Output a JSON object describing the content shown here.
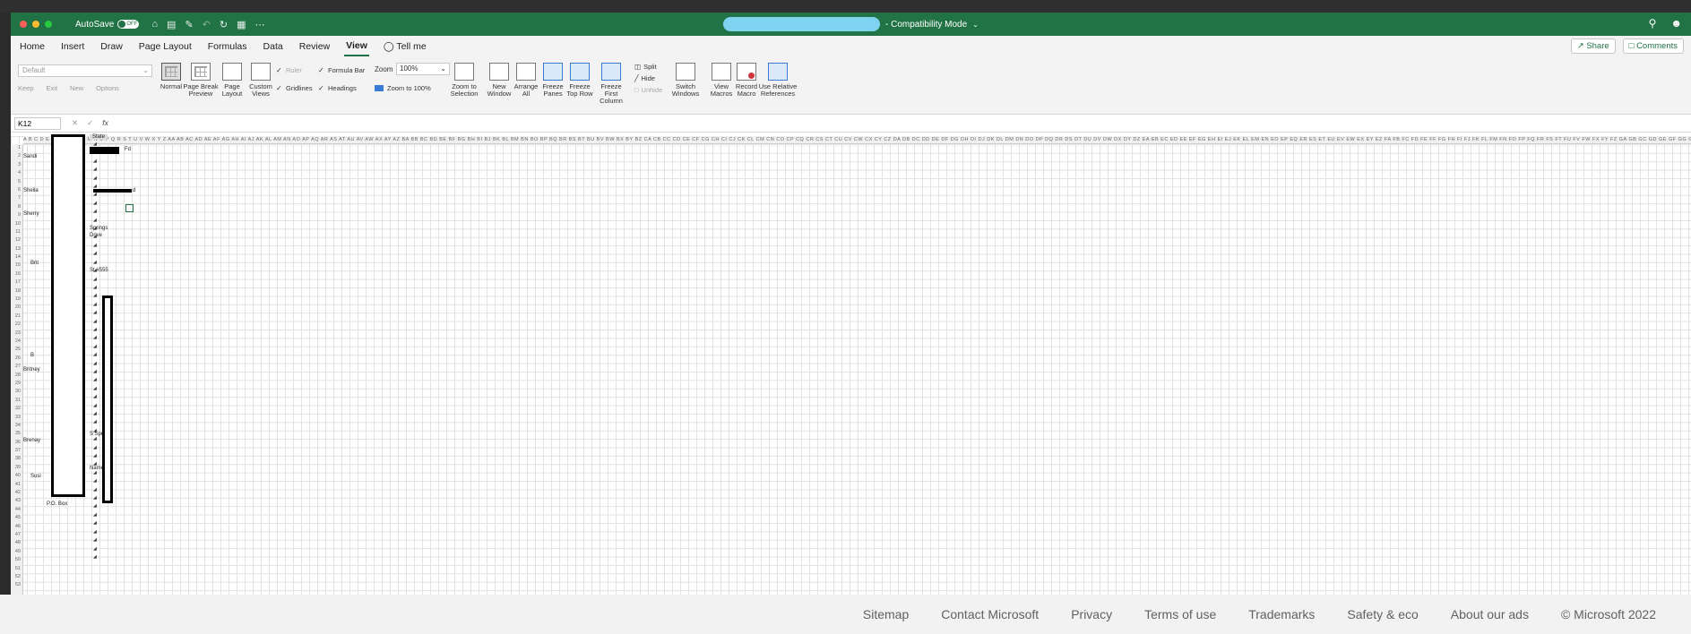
{
  "titlebar": {
    "autosave_label": "AutoSave",
    "autosave_state": "OFF",
    "mode_label": "- Compatibility Mode",
    "colors": {
      "titlebar": "#217346",
      "redacted_filename": "#7fd3f0"
    }
  },
  "menu": {
    "tabs": [
      "Home",
      "Insert",
      "Draw",
      "Page Layout",
      "Formulas",
      "Data",
      "Review",
      "View",
      "Tell me"
    ],
    "active_tab": "View",
    "share_label": "Share",
    "comments_label": "Comments"
  },
  "ribbon": {
    "sheet_view_select": "Default",
    "sheet_view_buttons": [
      "Keep",
      "Exit",
      "New",
      "Options"
    ],
    "views": [
      {
        "label": "Normal"
      },
      {
        "label": "Page Break Preview"
      },
      {
        "label": "Page Layout"
      },
      {
        "label": "Custom Views"
      }
    ],
    "show": {
      "ruler": "Ruler",
      "formula_bar": "Formula Bar",
      "gridlines": "Gridlines",
      "headings": "Headings"
    },
    "zoom": {
      "label": "Zoom",
      "value": "100%",
      "zoom_100": "Zoom to 100%",
      "zoom_selection": "Zoom to Selection"
    },
    "window": {
      "new_window": "New Window",
      "arrange_all": "Arrange All",
      "freeze_panes": "Freeze Panes",
      "freeze_top_row": "Freeze Top Row",
      "freeze_first_col": "Freeze First Column",
      "split": "Split",
      "hide": "Hide",
      "unhide": "Unhide",
      "switch_windows": "Switch Windows"
    },
    "macros": {
      "view_macros": "View Macros",
      "record_macro": "Record Macro",
      "relative_refs": "Use Relative References"
    }
  },
  "formula_bar": {
    "name_box": "K12",
    "fx": "fx"
  },
  "sheet": {
    "column_headers": "A B C D E F G H I J K L M N O P Q R S T U V W X Y Z AA AB AC AD AE AF AG AH AI AJ AK AL AM AN AO AP AQ AR AS AT AU AV AW AX AY AZ BA BB BC BD BE BF BG BH BI BJ BK BL BM BN BO BP BQ BR BS BT BU BV BW BX BY BZ CA CB CC CD CE CF CG CH CI CJ CK CL CM CN CO CP CQ CR CS CT CU CV CW CX CY CZ DA DB DC DD DE DF DG DH DI DJ DK DL DM DN DO DP DQ DR DS DT DU DV DW DX DY DZ EA EB EC ED EE EF EG EH EI EJ EK EL EM EN EO EP EQ ER ES ET EU EV EW EX EY EZ FA FB FC FD FE FF FG FH FI FJ FK FL FM FN FO FP FQ FR FS FT FU FV FW FX FY FZ GA GB GC GD GE GF GG GH GI GJ GK GL GM GN GO GP GQ GR GS GT GU GV GW GX GY GZ HA HB HC HD HE HF HG HH HI HJ HK HL HM HN HO HP HQ HR HS HT HU HV HW HX HY HZ IA IB IC ID IE IF IG IH II IJ IK IL IM IN IO IP IQ IR",
    "cells": {
      "header_state": "State",
      "sandi": "Sandi",
      "fd": "Fd",
      "sheila": "Sheila",
      "d": "d",
      "sherry": "Sherry",
      "springs": "Springs",
      "drive": "Drive",
      "brit": "Brit",
      "ste": "St #555",
      "b": "B",
      "britney": "Britney",
      "brenay": "Brenay",
      "susi": "Susi",
      "name": "Name",
      "po_box": "P.O. Box",
      "s_springs": "S Springs"
    }
  }
}
